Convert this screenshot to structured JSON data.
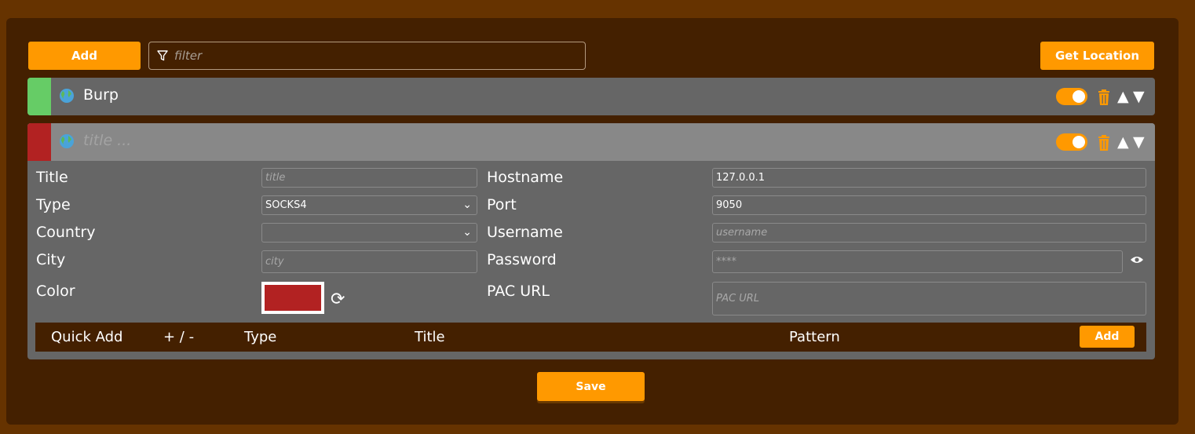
{
  "toolbar": {
    "add_label": "Add",
    "filter_placeholder": "filter",
    "get_location_label": "Get Location"
  },
  "proxies": [
    {
      "title": "Burp",
      "color": "#66cc66",
      "enabled": true
    },
    {
      "title": "",
      "title_placeholder": "title ...",
      "color": "#b22222",
      "enabled": true
    }
  ],
  "editor": {
    "title_label": "Title",
    "title_placeholder": "title",
    "type_label": "Type",
    "type_value": "SOCKS4",
    "country_label": "Country",
    "country_value": "",
    "city_label": "City",
    "city_placeholder": "city",
    "color_label": "Color",
    "color_value": "#b22222",
    "hostname_label": "Hostname",
    "hostname_value": "127.0.0.1",
    "port_label": "Port",
    "port_value": "9050",
    "username_label": "Username",
    "username_placeholder": "username",
    "password_label": "Password",
    "password_placeholder": "****",
    "pac_label": "PAC URL",
    "pac_placeholder": "PAC URL"
  },
  "quick_add": {
    "quick_add_label": "Quick Add",
    "plus_minus_label": "+ / -",
    "type_label": "Type",
    "title_label": "Title",
    "pattern_label": "Pattern",
    "add_label": "Add"
  },
  "footer": {
    "save_label": "Save"
  },
  "colors": {
    "accent": "#ff9900",
    "background": "#663300",
    "panel": "#442000",
    "row": "#666666"
  }
}
